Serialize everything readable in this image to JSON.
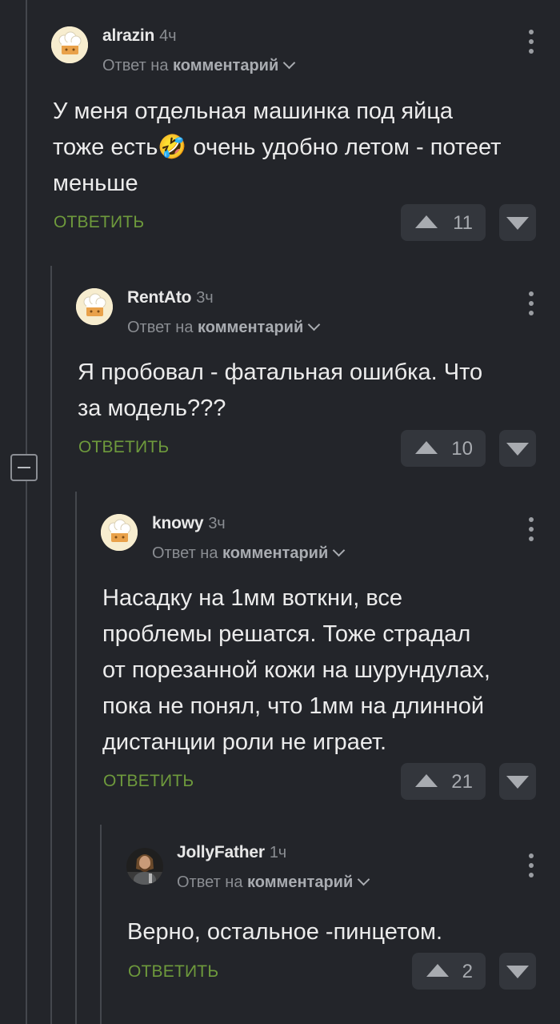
{
  "labels": {
    "reply_prefix": "Ответ на",
    "reply_target": "комментарий",
    "reply_action": "ОТВЕТИТЬ"
  },
  "comments": [
    {
      "author": "alrazin",
      "time": "4ч",
      "avatar": "chef-hat-avatar",
      "text": "У меня отдельная машинка под яйца\nтоже есть🤣 очень удобно летом - потеет\nменьше",
      "votes": "11"
    },
    {
      "author": "RentAto",
      "time": "3ч",
      "avatar": "chef-hat-avatar",
      "text": "Я пробовал - фатальная ошибка. Что\nза модель???",
      "votes": "10"
    },
    {
      "author": "knowy",
      "time": "3ч",
      "avatar": "chef-hat-avatar",
      "text": "Насадку на 1мм воткни, все\nпроблемы решатся. Тоже страдал\nот порезанной кожи на шурундулах,\nпока не понял, что 1мм на длинной\nдистанции роли не играет.",
      "votes": "21"
    },
    {
      "author": "JollyFather",
      "time": "1ч",
      "avatar": "photo-avatar",
      "text": "Верно, остальное -пинцетом.",
      "votes": "2"
    }
  ],
  "colors": {
    "background": "#23252a",
    "reply_link": "#6e9a3c",
    "vote_button": "#33363c"
  }
}
